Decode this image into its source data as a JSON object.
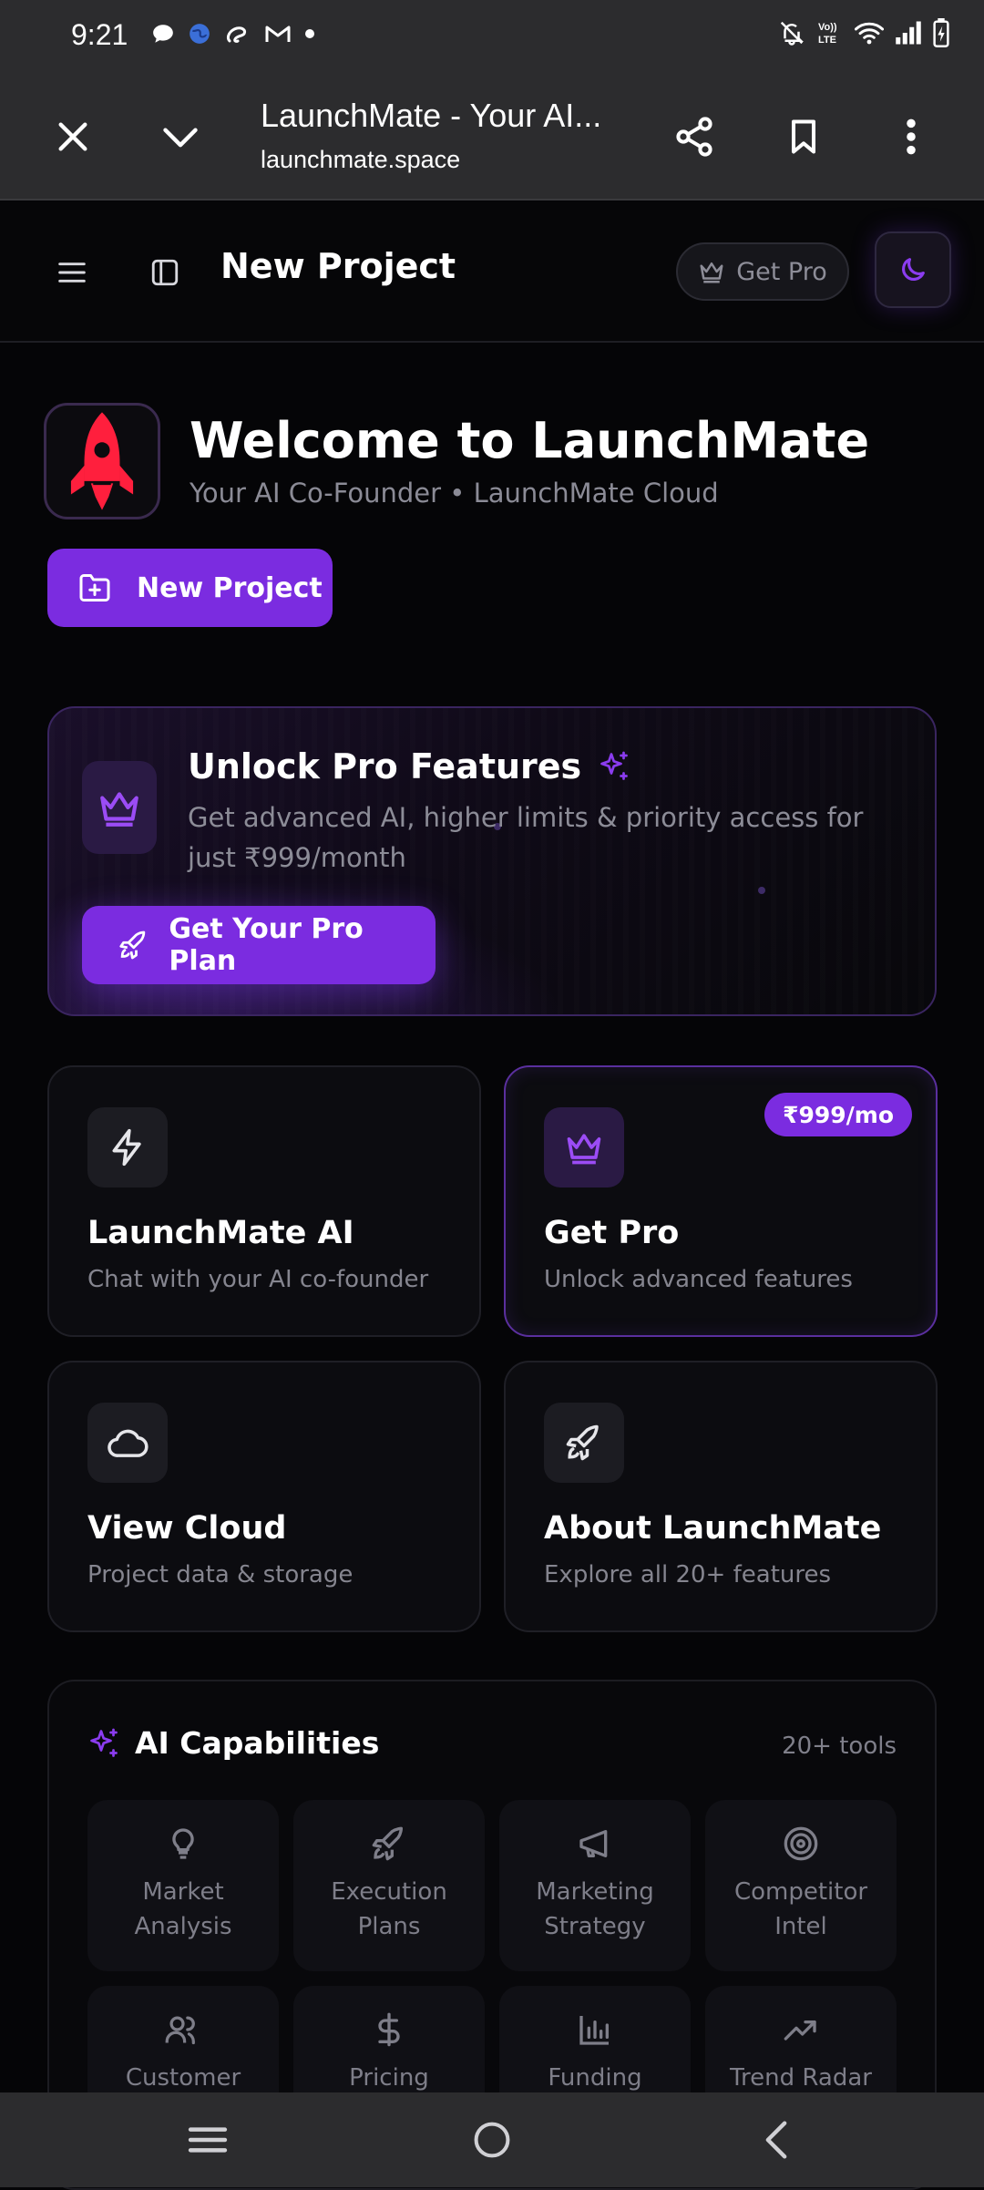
{
  "status_bar": {
    "time": "9:21"
  },
  "browser": {
    "title": "LaunchMate - Your AI...",
    "url": "launchmate.space"
  },
  "header": {
    "page_title": "New Project",
    "get_pro_label": "Get Pro"
  },
  "welcome": {
    "title": "Welcome to LaunchMate",
    "subtitle": "Your AI Co-Founder • LaunchMate Cloud",
    "new_project_label": "New Project"
  },
  "pro_banner": {
    "title": "Unlock Pro Features",
    "description": "Get advanced AI, higher limits & priority access for just ₹999/month",
    "button_label": "Get Your Pro Plan"
  },
  "feature_cards": [
    {
      "title": "LaunchMate AI",
      "subtitle": "Chat with your AI co-founder",
      "icon": "lightning-icon"
    },
    {
      "title": "Get Pro",
      "subtitle": "Unlock advanced features",
      "icon": "crown-icon",
      "badge": "₹999/mo"
    },
    {
      "title": "View Cloud",
      "subtitle": "Project data & storage",
      "icon": "cloud-icon"
    },
    {
      "title": "About LaunchMate",
      "subtitle": "Explore all 20+ features",
      "icon": "rocket-icon"
    }
  ],
  "capabilities": {
    "title": "AI Capabilities",
    "count": "20+ tools",
    "tools": [
      {
        "label": "Market Analysis",
        "icon": "lightbulb-icon"
      },
      {
        "label": "Execution Plans",
        "icon": "rocket-icon"
      },
      {
        "label": "Marketing Strategy",
        "icon": "megaphone-icon"
      },
      {
        "label": "Competitor Intel",
        "icon": "target-icon"
      },
      {
        "label": "Customer",
        "icon": "users-icon"
      },
      {
        "label": "Pricing",
        "icon": "dollar-icon"
      },
      {
        "label": "Funding",
        "icon": "bar-chart-icon"
      },
      {
        "label": "Trend Radar",
        "icon": "trending-up-icon"
      }
    ]
  },
  "colors": {
    "accent": "#7b2ce0",
    "background": "#050507",
    "card": "#0c0c10",
    "logo_red": "#ff1f3d"
  }
}
